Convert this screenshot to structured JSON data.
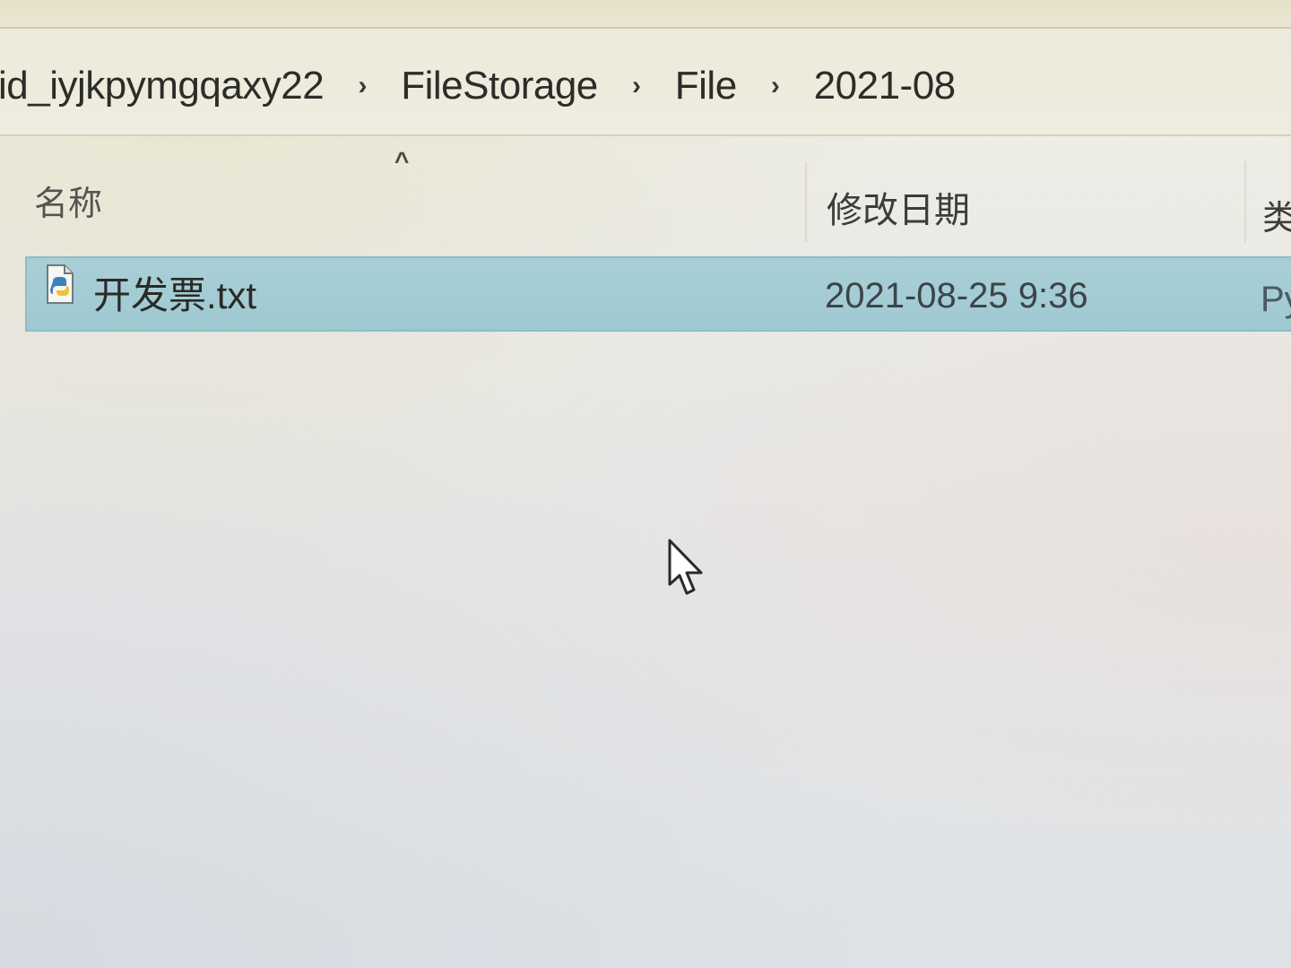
{
  "breadcrumb": {
    "items": [
      "id_iyjkpymgqaxy22",
      "FileStorage",
      "File",
      "2021-08"
    ],
    "separator": "›"
  },
  "columns": {
    "sort_indicator": "^",
    "name": "名称",
    "date_modified": "修改日期",
    "type": "类"
  },
  "files": [
    {
      "name": "开发票.txt",
      "date_modified": "2021-08-25 9:36",
      "type": "Py",
      "icon": "python-file-icon",
      "selected": true
    }
  ],
  "colors": {
    "selection": "#a9cfd6",
    "selection_border": "#8dbdc8",
    "background": "#e8e8e6"
  }
}
